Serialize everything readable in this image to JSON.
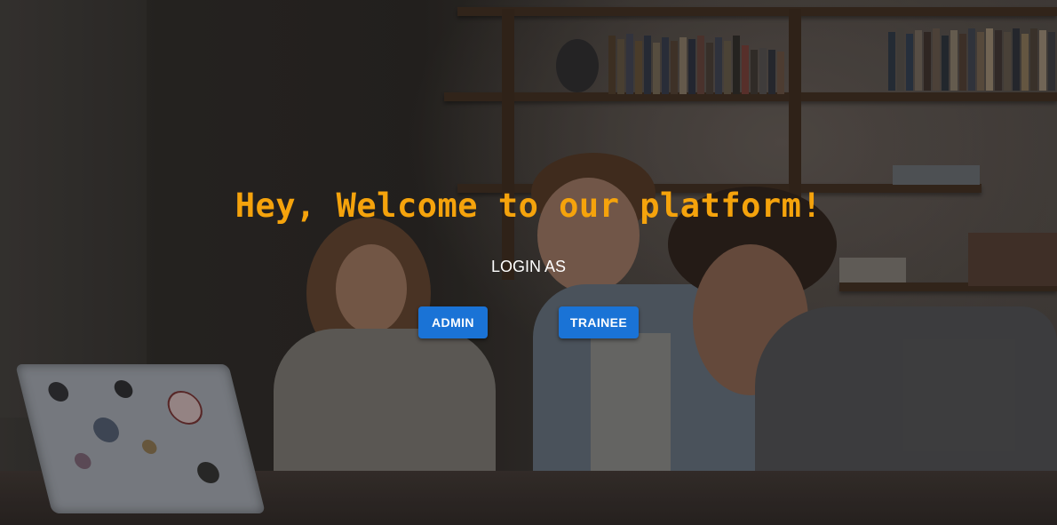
{
  "hero": {
    "welcome_text": "Hey, Welcome to our platform!",
    "login_label": "LOGIN AS"
  },
  "buttons": {
    "admin_label": "ADMIN",
    "trainee_label": "TRAINEE"
  },
  "colors": {
    "welcome_text": "#f5a30c",
    "button_bg": "#1a73d6",
    "button_text": "#ffffff",
    "login_label": "#ffffff"
  }
}
